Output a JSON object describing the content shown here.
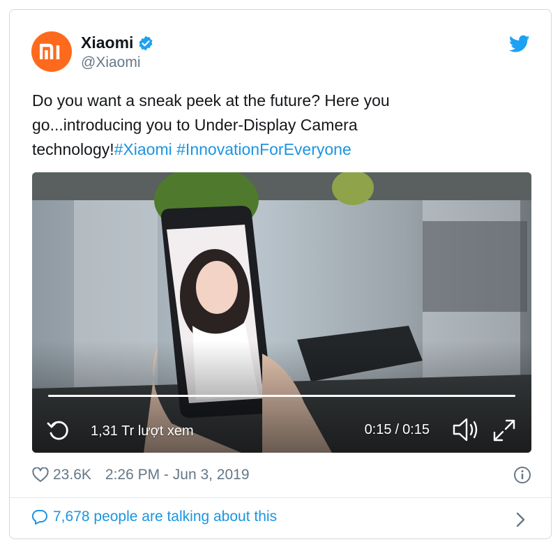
{
  "author": {
    "name": "Xiaomi",
    "handle": "@Xiaomi",
    "avatar_text": "mi",
    "verified_icon": "verified-badge-icon",
    "brand_color": "#fe6a1d"
  },
  "tweet": {
    "text_plain": "Do you want a sneak peek at the future? Here you go...introducing you to Under-Display Camera technology!",
    "hashtags": [
      "#Xiaomi",
      "#InnovationForEveryone"
    ],
    "link_color": "#1b95e0"
  },
  "video": {
    "progress": 1.0,
    "views": "1,31 Tr lượt xem",
    "current_time": "0:15",
    "time_separator": "/",
    "duration": "0:15",
    "controls": [
      "replay-icon",
      "volume-icon",
      "fullscreen-icon"
    ]
  },
  "meta": {
    "likes": "23.6K",
    "timestamp": "2:26 PM - Jun 3, 2019"
  },
  "conversation": {
    "label": "7,678 people are talking about this"
  }
}
